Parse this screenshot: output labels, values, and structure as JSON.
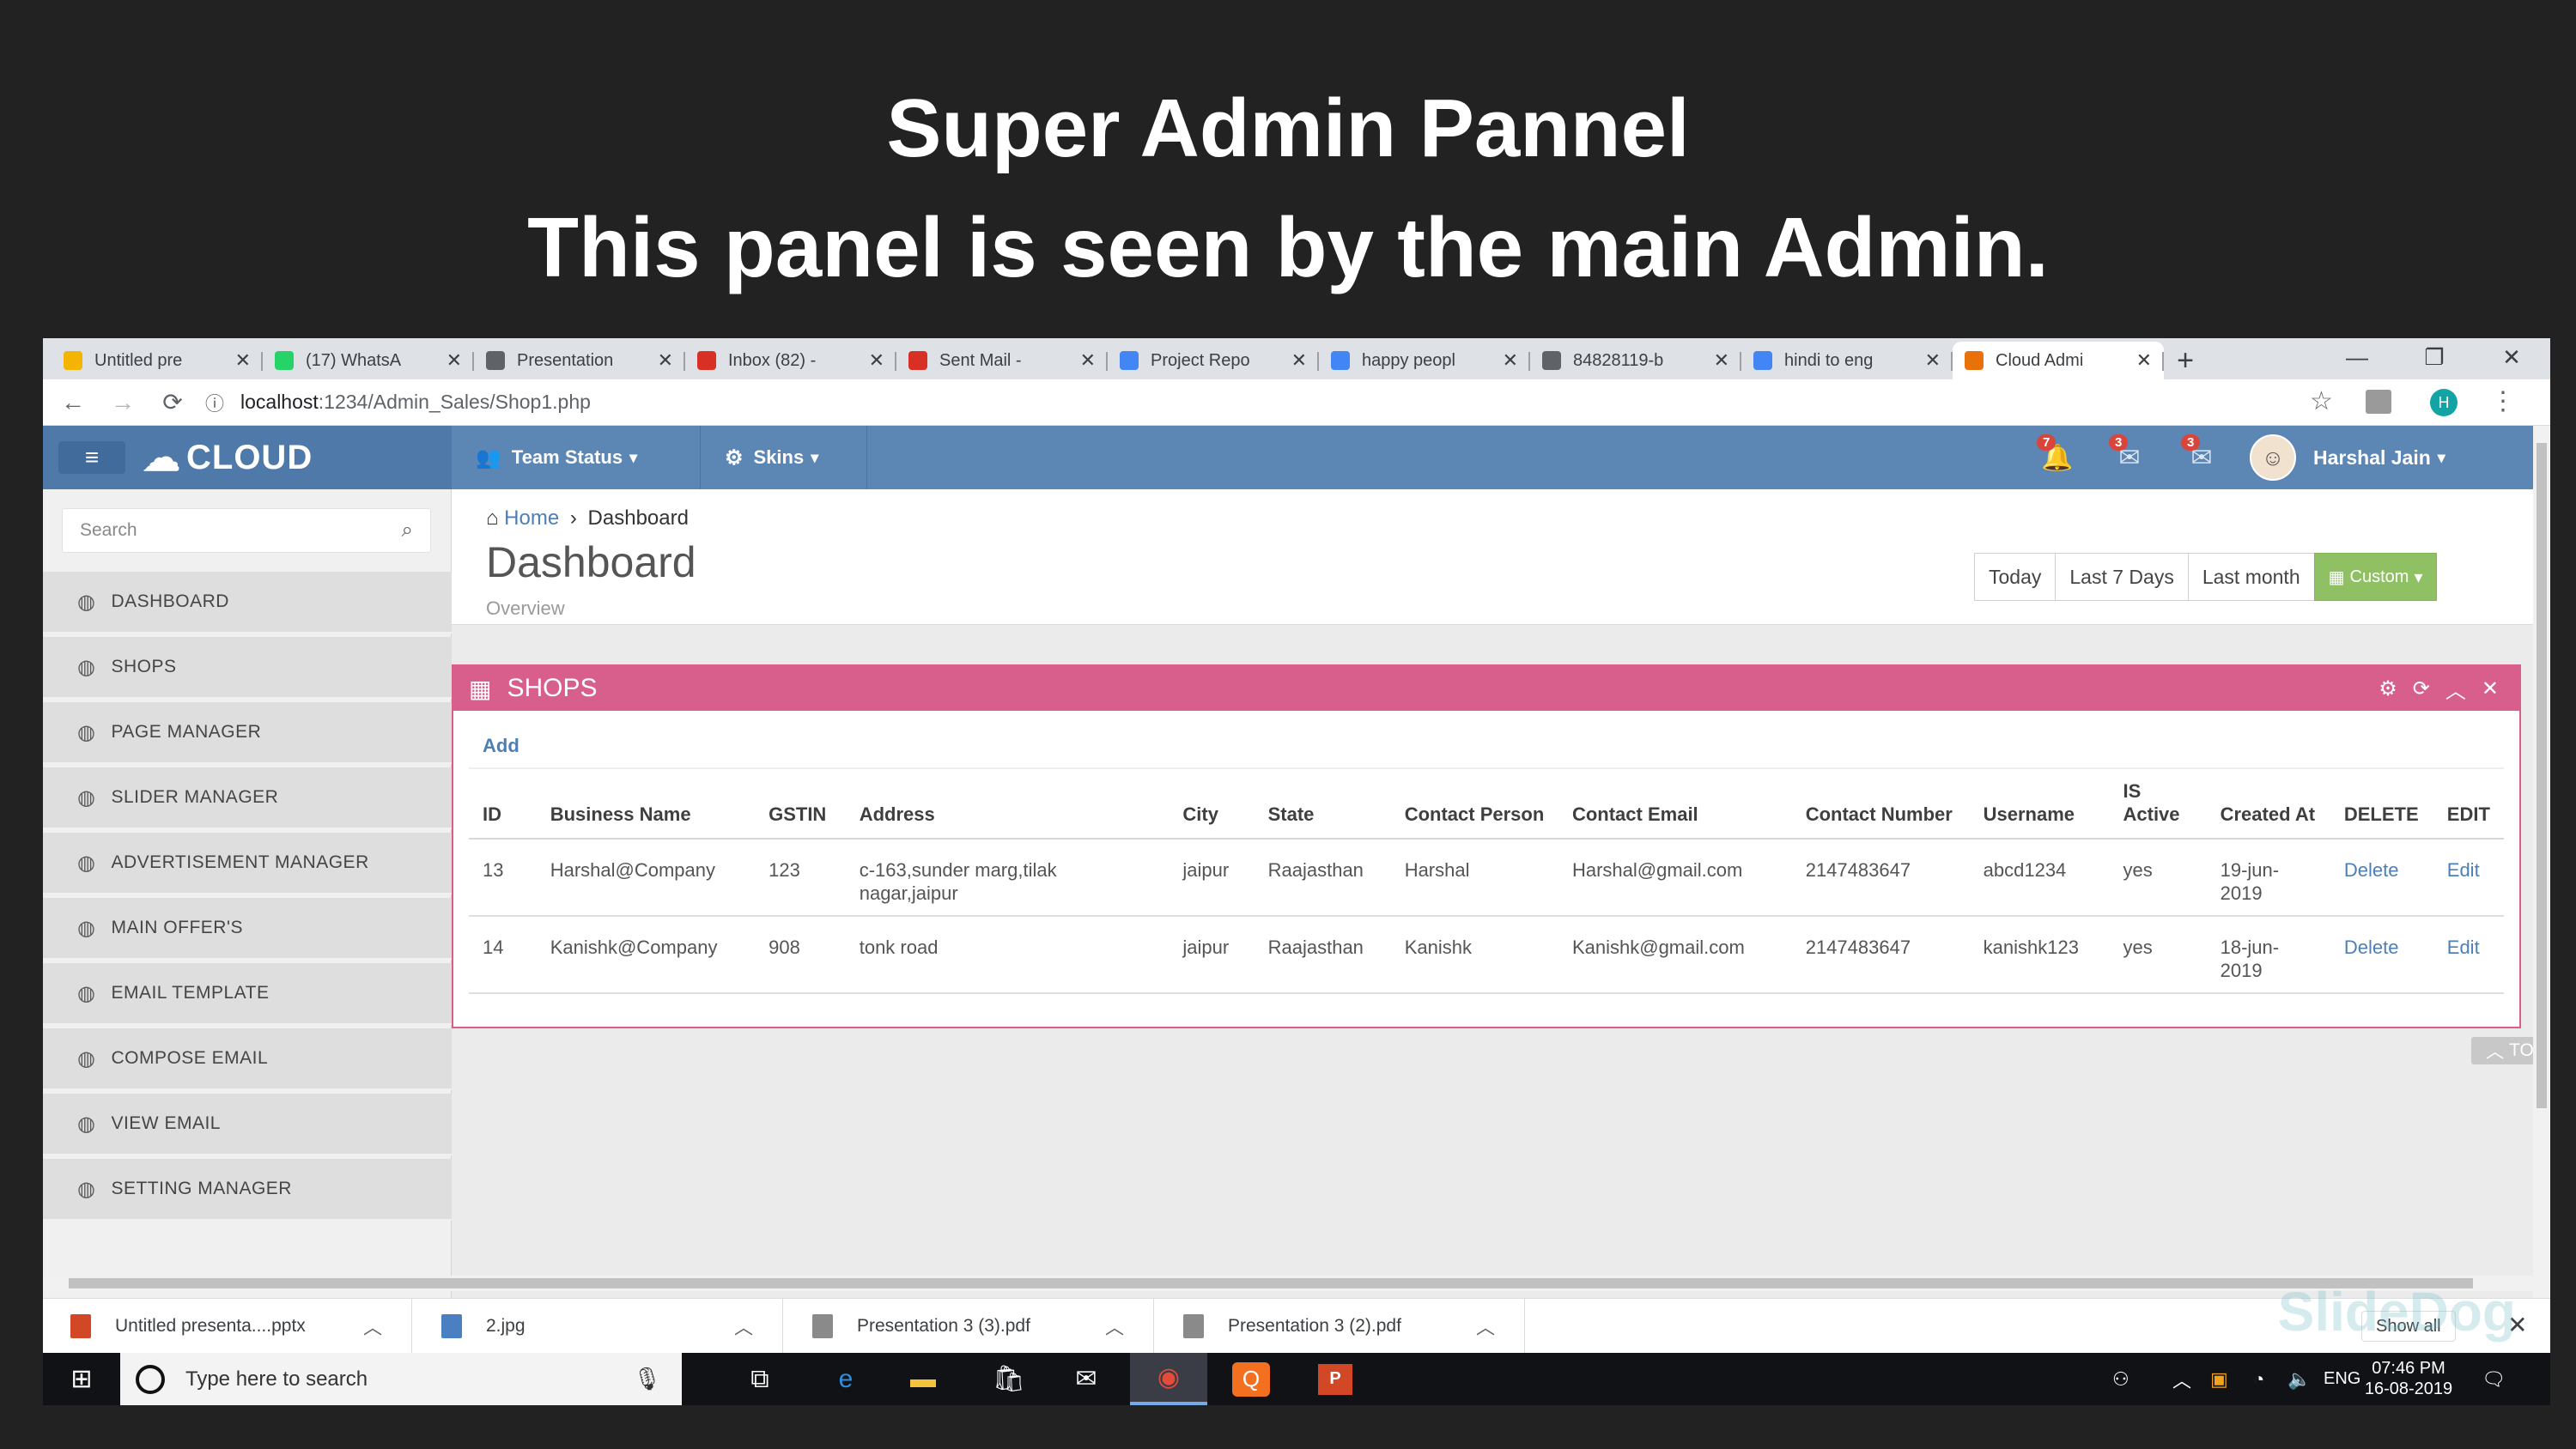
{
  "slide": {
    "title": "Super Admin Pannel",
    "subtitle": "This panel is seen by the main Admin."
  },
  "browser": {
    "tabs": [
      {
        "label": "Untitled pre",
        "icon": "slides-icon",
        "color": "#f4b400"
      },
      {
        "label": "(17) WhatsA",
        "icon": "whatsapp-icon",
        "color": "#25d366"
      },
      {
        "label": "Presentation",
        "icon": "globe-icon",
        "color": "#5f6368"
      },
      {
        "label": "Inbox (82) - ",
        "icon": "gmail-icon",
        "color": "#d93025"
      },
      {
        "label": "Sent Mail - ",
        "icon": "gmail-icon",
        "color": "#d93025"
      },
      {
        "label": "Project Repo",
        "icon": "docs-icon",
        "color": "#4285f4"
      },
      {
        "label": "happy peopl",
        "icon": "google-icon",
        "color": "#4285f4"
      },
      {
        "label": "84828119-b",
        "icon": "globe-icon",
        "color": "#5f6368"
      },
      {
        "label": "hindi to eng",
        "icon": "google-icon",
        "color": "#4285f4"
      },
      {
        "label": "Cloud Admi",
        "icon": "cloud-admin-icon",
        "color": "#e8710a"
      }
    ],
    "url_host": "localhost",
    "url_path": ":1234/Admin_Sales/Shop1.php",
    "profile_initial": "H"
  },
  "app": {
    "brand": "CLOUD",
    "menu": [
      {
        "label": "Team Status",
        "icon": "users-icon"
      },
      {
        "label": "Skins",
        "icon": "gear-icon"
      }
    ],
    "notifications": [
      {
        "count": "7",
        "icon": "bell-icon"
      },
      {
        "count": "3",
        "icon": "envelope-icon"
      },
      {
        "count": "3",
        "icon": "inbox-icon"
      }
    ],
    "user_name": "Harshal Jain",
    "search_placeholder": "Search",
    "sidebar": [
      "DASHBOARD",
      "SHOPS",
      "PAGE MANAGER",
      "SLIDER MANAGER",
      "ADVERTISEMENT MANAGER",
      "MAIN OFFER'S",
      "EMAIL TEMPLATE",
      "COMPOSE EMAIL",
      "VIEW EMAIL",
      "SETTING MANAGER"
    ],
    "breadcrumb_home": "Home",
    "breadcrumb_current": "Dashboard",
    "page_title": "Dashboard",
    "page_subtitle": "Overview",
    "ranges": [
      "Today",
      "Last 7 Days",
      "Last month",
      "Custom"
    ],
    "widget_title": "SHOPS",
    "add_label": "Add",
    "columns": [
      "ID",
      "Business Name",
      "GSTIN",
      "Address",
      "City",
      "State",
      "Contact Person",
      "Contact Email",
      "Contact Number",
      "Username",
      "IS Active",
      "Created At",
      "DELETE",
      "EDIT"
    ],
    "rows": [
      [
        "13",
        "Harshal@Company",
        "123",
        "c-163,sunder marg,tilak nagar,jaipur",
        "jaipur",
        "Raajasthan",
        "Harshal",
        "Harshal@gmail.com",
        "2147483647",
        "abcd1234",
        "yes",
        "19-jun-2019",
        "Delete",
        "Edit"
      ],
      [
        "14",
        "Kanishk@Company",
        "908",
        "tonk road",
        "jaipur",
        "Raajasthan",
        "Kanishk",
        "Kanishk@gmail.com",
        "2147483647",
        "kanishk123",
        "yes",
        "18-jun-2019",
        "Delete",
        "Edit"
      ]
    ],
    "top_label": "TOP"
  },
  "downloads": {
    "items": [
      {
        "name": "Untitled presenta....pptx",
        "color": "#d24726"
      },
      {
        "name": "2.jpg",
        "color": "#4a7fc1"
      },
      {
        "name": "Presentation 3 (3).pdf",
        "color": "#8a8a8a"
      },
      {
        "name": "Presentation 3 (2).pdf",
        "color": "#8a8a8a"
      }
    ],
    "show_all": "Show all"
  },
  "watermark": "SlideDog",
  "taskbar": {
    "search_placeholder": "Type here to search",
    "language": "ENG",
    "time": "07:46 PM",
    "date": "16-08-2019"
  },
  "colors": {
    "header_blue": "#5c86b4",
    "widget_pink": "#d85e8c",
    "custom_green": "#8fc063",
    "link_blue": "#4d7fb5"
  }
}
